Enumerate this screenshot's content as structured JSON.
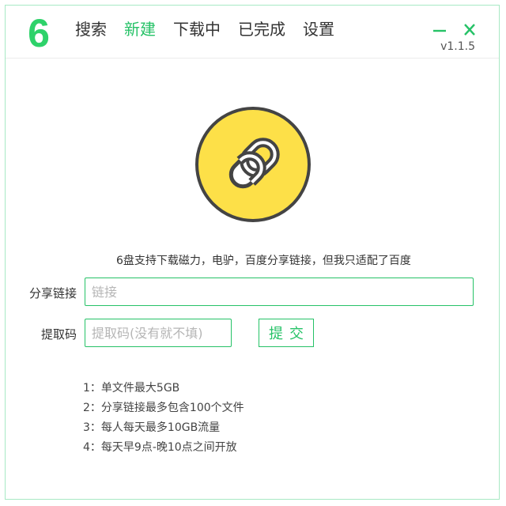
{
  "app": {
    "logo_text": "6",
    "version": "v1.1.5"
  },
  "nav": {
    "items": [
      {
        "label": "搜索",
        "active": false
      },
      {
        "label": "新建",
        "active": true
      },
      {
        "label": "下载中",
        "active": false
      },
      {
        "label": "已完成",
        "active": false
      },
      {
        "label": "设置",
        "active": false
      }
    ]
  },
  "window_controls": {
    "minimize_icon": "minimize-icon",
    "close_icon": "close-icon"
  },
  "main": {
    "hero_icon": "link-chain-icon",
    "description": "6盘支持下载磁力，电驴，百度分享链接，但我只适配了百度",
    "share_link": {
      "label": "分享链接",
      "placeholder": "链接",
      "value": ""
    },
    "extract_code": {
      "label": "提取码",
      "placeholder": "提取码(没有就不填)",
      "value": ""
    },
    "submit_label": "提交",
    "tips": [
      "1：单文件最大5GB",
      "2：分享链接最多包含100个文件",
      "3：每人每天最多10GB流量",
      "4：每天早9点-晚10点之间开放"
    ]
  },
  "colors": {
    "accent": "#26c267",
    "logo_green": "#2ed26a",
    "hero_yellow": "#fde048",
    "hero_outline": "#444444"
  }
}
